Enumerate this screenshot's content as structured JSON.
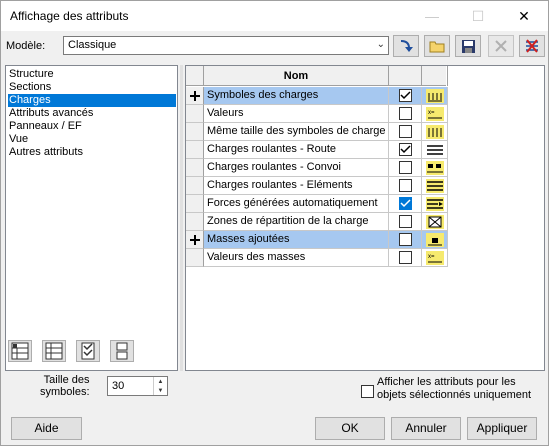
{
  "window": {
    "title": "Affichage des attributs",
    "minimize": "—",
    "maximize": "☐",
    "close": "✕"
  },
  "model": {
    "label": "Modèle:",
    "value": "Classique",
    "toolbar": [
      "apply-icon",
      "folder-icon",
      "save-icon",
      "delete-icon",
      "clear-icon"
    ]
  },
  "categories": {
    "items": [
      "Structure",
      "Sections",
      "Charges",
      "Attributs avancés",
      "Panneaux / EF",
      "Vue",
      "Autres attributs"
    ],
    "selected": "Charges"
  },
  "grid": {
    "header": "Nom",
    "rows": [
      {
        "name": "Symboles des charges",
        "checked": true,
        "group": true,
        "icon": "load-symbol-icon"
      },
      {
        "name": "Valeurs",
        "checked": false,
        "group": false,
        "icon": "value-symbol-icon"
      },
      {
        "name": "Même taille des symboles de charge",
        "checked": false,
        "group": false,
        "icon": "same-size-icon"
      },
      {
        "name": "Charges roulantes - Route",
        "checked": true,
        "group": false,
        "icon": "moving-route-icon"
      },
      {
        "name": "Charges roulantes - Convoi",
        "checked": false,
        "group": false,
        "icon": "moving-convoy-icon"
      },
      {
        "name": "Charges roulantes - Eléments",
        "checked": false,
        "group": false,
        "icon": "moving-elements-icon"
      },
      {
        "name": "Forces générées automatiquement",
        "checked": true,
        "group": false,
        "icon": "auto-forces-icon",
        "focused": true
      },
      {
        "name": "Zones de répartition de la charge",
        "checked": false,
        "group": false,
        "icon": "zones-icon"
      },
      {
        "name": "Masses ajoutées",
        "checked": false,
        "group": true,
        "icon": "added-mass-icon"
      },
      {
        "name": "Valeurs des masses",
        "checked": false,
        "group": false,
        "icon": "mass-values-icon"
      }
    ]
  },
  "symbol_size": {
    "label_line1": "Taille des",
    "label_line2": "symboles:",
    "value": "30"
  },
  "selected_only": {
    "label_line1": "Afficher les attributs pour les",
    "label_line2": "objets sélectionnés uniquement",
    "checked": false
  },
  "buttons": {
    "help": "Aide",
    "ok": "OK",
    "cancel": "Annuler",
    "apply": "Appliquer"
  }
}
